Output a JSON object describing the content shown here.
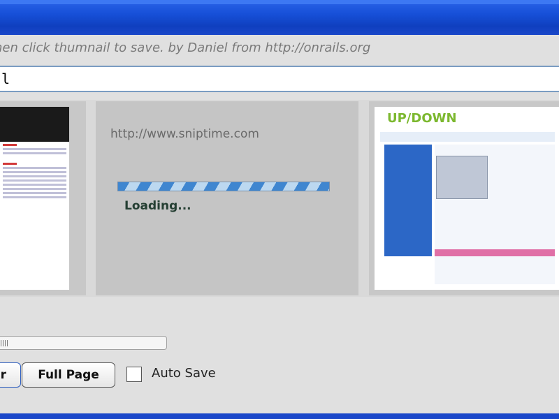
{
  "header": {
    "hint": "hen click thumnail to save. by Daniel from http://onrails.org"
  },
  "url_input": {
    "value": "l"
  },
  "thumbnails": [
    {
      "type": "screenshot"
    },
    {
      "url": "http://www.sniptime.com",
      "status": "Loading..."
    },
    {
      "logo": "UP/DOWN"
    }
  ],
  "controls": {
    "partial_button": "r",
    "full_page_button": "Full Page",
    "auto_save_label": "Auto Save",
    "auto_save_checked": false
  },
  "colors": {
    "titlebar": "#1750d8",
    "progress": "#3f86d0",
    "logo_green": "#7cb82f"
  }
}
